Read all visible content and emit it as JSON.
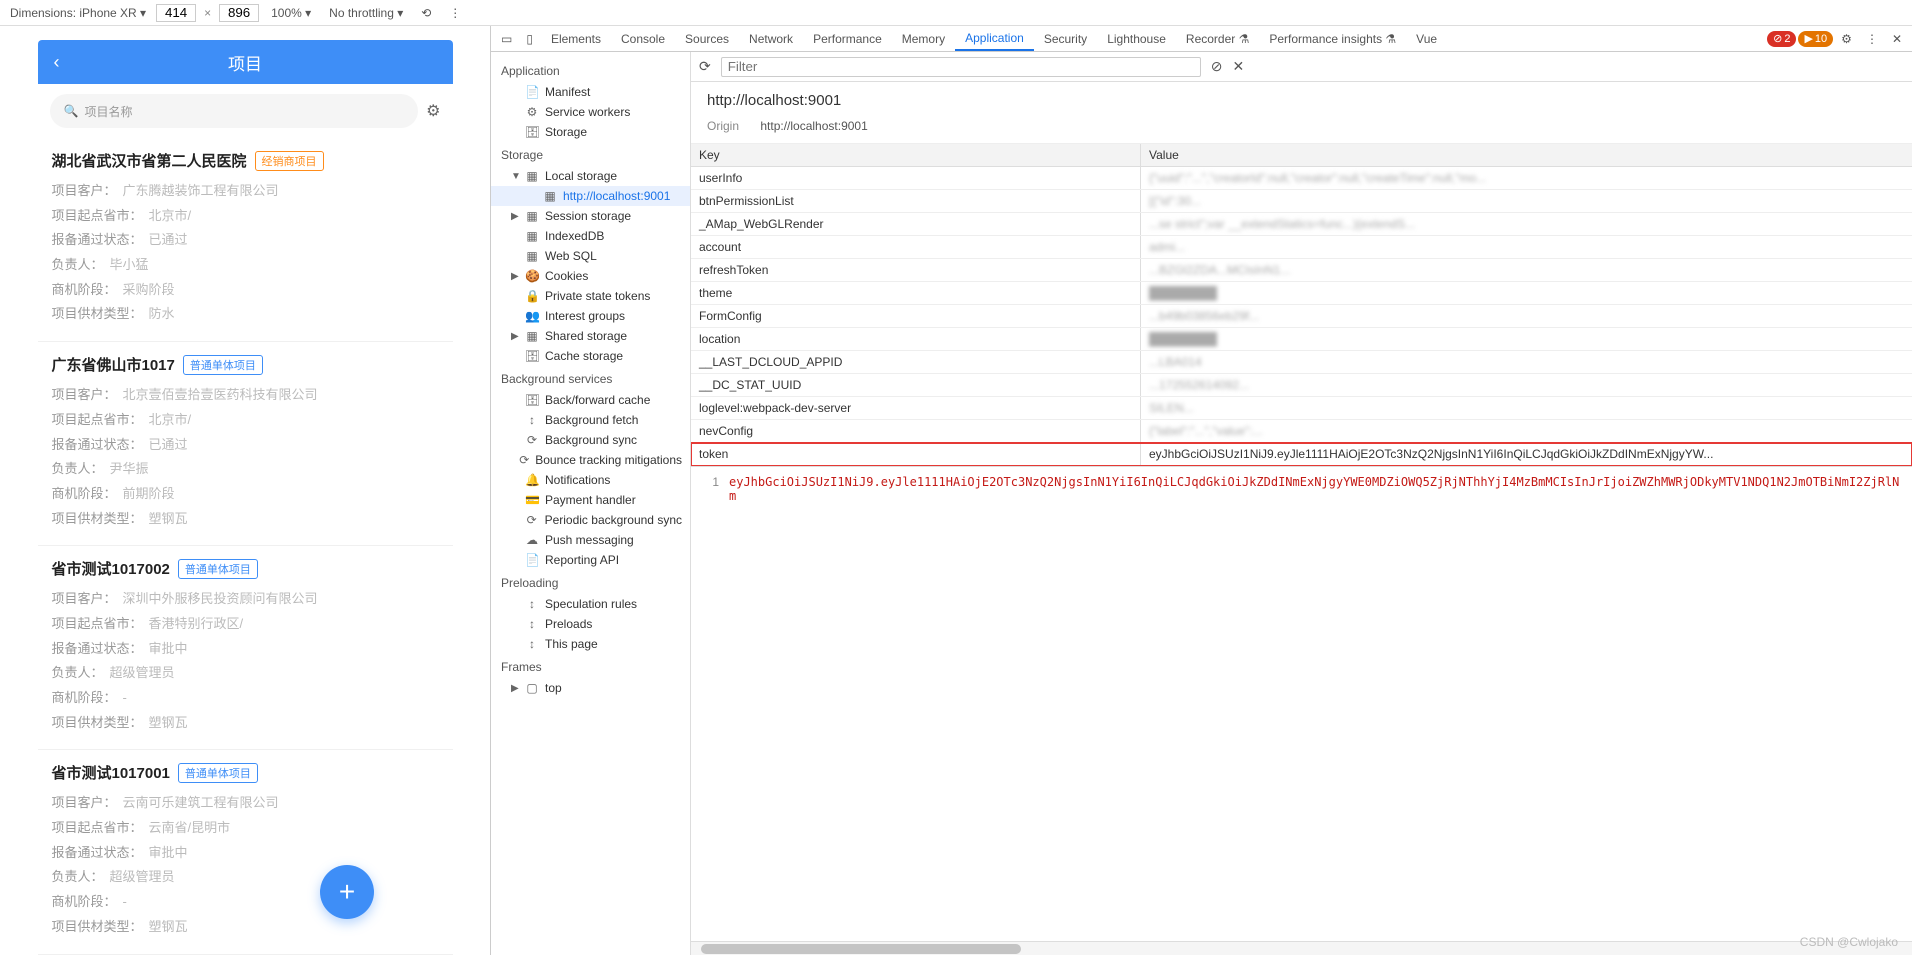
{
  "toolbar": {
    "dimensions_label": "Dimensions: iPhone XR ▾",
    "width": "414",
    "height": "896",
    "zoom": "100% ▾",
    "throttling": "No throttling ▾"
  },
  "phone": {
    "header_title": "项目",
    "search_placeholder": "项目名称",
    "cards": [
      {
        "title": "湖北省武汉市省第二人民医院",
        "badge": "经销商项目",
        "badge_class": "badge-orange",
        "rows": [
          {
            "lbl": "项目客户：",
            "val": "广东腾越装饰工程有限公司"
          },
          {
            "lbl": "项目起点省市：",
            "val": "北京市/"
          },
          {
            "lbl": "报备通过状态：",
            "val": "已通过"
          },
          {
            "lbl": "负责人：",
            "val": "毕小猛"
          },
          {
            "lbl": "商机阶段：",
            "val": "采购阶段"
          },
          {
            "lbl": "项目供材类型：",
            "val": "防水"
          }
        ]
      },
      {
        "title": "广东省佛山市1017",
        "badge": "普通单体项目",
        "badge_class": "badge-blue",
        "rows": [
          {
            "lbl": "项目客户：",
            "val": "北京壹佰壹拾壹医药科技有限公司"
          },
          {
            "lbl": "项目起点省市：",
            "val": "北京市/"
          },
          {
            "lbl": "报备通过状态：",
            "val": "已通过"
          },
          {
            "lbl": "负责人：",
            "val": "尹华振"
          },
          {
            "lbl": "商机阶段：",
            "val": "前期阶段"
          },
          {
            "lbl": "项目供材类型：",
            "val": "塑钢瓦"
          }
        ]
      },
      {
        "title": "省市测试1017002",
        "badge": "普通单体项目",
        "badge_class": "badge-blue",
        "rows": [
          {
            "lbl": "项目客户：",
            "val": "深圳中外服移民投资顾问有限公司"
          },
          {
            "lbl": "项目起点省市：",
            "val": "香港特别行政区/"
          },
          {
            "lbl": "报备通过状态：",
            "val": "审批中"
          },
          {
            "lbl": "负责人：",
            "val": "超级管理员"
          },
          {
            "lbl": "商机阶段：",
            "val": "-"
          },
          {
            "lbl": "项目供材类型：",
            "val": "塑钢瓦"
          }
        ]
      },
      {
        "title": "省市测试1017001",
        "badge": "普通单体项目",
        "badge_class": "badge-blue",
        "rows": [
          {
            "lbl": "项目客户：",
            "val": "云南可乐建筑工程有限公司"
          },
          {
            "lbl": "项目起点省市：",
            "val": "云南省/昆明市"
          },
          {
            "lbl": "报备通过状态：",
            "val": "审批中"
          },
          {
            "lbl": "负责人：",
            "val": "超级管理员"
          },
          {
            "lbl": "商机阶段：",
            "val": "-"
          },
          {
            "lbl": "项目供材类型：",
            "val": "塑钢瓦"
          }
        ]
      }
    ]
  },
  "devtools": {
    "tabs": [
      "Elements",
      "Console",
      "Sources",
      "Network",
      "Performance",
      "Memory",
      "Application",
      "Security",
      "Lighthouse",
      "Recorder ⚗",
      "Performance insights ⚗",
      "Vue"
    ],
    "active_tab": "Application",
    "error_red": "2",
    "error_yellow": "10",
    "sidebar": {
      "groups": [
        {
          "title": "Application",
          "items": [
            {
              "icon": "📄",
              "label": "Manifest"
            },
            {
              "icon": "⚙",
              "label": "Service workers"
            },
            {
              "icon": "🗄",
              "label": "Storage"
            }
          ]
        },
        {
          "title": "Storage",
          "items": [
            {
              "arrow": "▼",
              "icon": "▦",
              "label": "Local storage",
              "children": [
                {
                  "icon": "▦",
                  "label": "http://localhost:9001",
                  "selected": true
                }
              ]
            },
            {
              "arrow": "▶",
              "icon": "▦",
              "label": "Session storage"
            },
            {
              "icon": "▦",
              "label": "IndexedDB"
            },
            {
              "icon": "▦",
              "label": "Web SQL"
            },
            {
              "arrow": "▶",
              "icon": "🍪",
              "label": "Cookies"
            },
            {
              "icon": "🔒",
              "label": "Private state tokens"
            },
            {
              "icon": "👥",
              "label": "Interest groups"
            },
            {
              "arrow": "▶",
              "icon": "▦",
              "label": "Shared storage"
            },
            {
              "icon": "🗄",
              "label": "Cache storage"
            }
          ]
        },
        {
          "title": "Background services",
          "items": [
            {
              "icon": "🗄",
              "label": "Back/forward cache"
            },
            {
              "icon": "↕",
              "label": "Background fetch"
            },
            {
              "icon": "⟳",
              "label": "Background sync"
            },
            {
              "icon": "⟳",
              "label": "Bounce tracking mitigations"
            },
            {
              "icon": "🔔",
              "label": "Notifications"
            },
            {
              "icon": "💳",
              "label": "Payment handler"
            },
            {
              "icon": "⟳",
              "label": "Periodic background sync"
            },
            {
              "icon": "☁",
              "label": "Push messaging"
            },
            {
              "icon": "📄",
              "label": "Reporting API"
            }
          ]
        },
        {
          "title": "Preloading",
          "items": [
            {
              "icon": "↕",
              "label": "Speculation rules"
            },
            {
              "icon": "↕",
              "label": "Preloads"
            },
            {
              "icon": "↕",
              "label": "This page"
            }
          ]
        },
        {
          "title": "Frames",
          "items": [
            {
              "arrow": "▶",
              "icon": "▢",
              "label": "top"
            }
          ]
        }
      ]
    },
    "detail": {
      "filter_placeholder": "Filter",
      "url_display": "http://localhost:9001",
      "origin_label": "Origin",
      "origin_value": "http://localhost:9001",
      "table_headers": {
        "key": "Key",
        "value": "Value"
      },
      "rows": [
        {
          "key": "userInfo",
          "val": "{\"uuid\":\"...\",\"creatorId\":null,\"creator\":null,\"createTime\":null,\"mo..."
        },
        {
          "key": "btnPermissionList",
          "val": "[{\"id\":30..."
        },
        {
          "key": "_AMap_WebGLRender",
          "val": "...se strict\";var __extendStatics=func...){extendS..."
        },
        {
          "key": "account",
          "val": "admi..."
        },
        {
          "key": "refreshToken",
          "val": "...BZGl2ZDA...MCIsInN1..."
        },
        {
          "key": "theme",
          "val": ""
        },
        {
          "key": "FormConfig",
          "val": "...b49b03856eb29f..."
        },
        {
          "key": "location",
          "val": ""
        },
        {
          "key": "__LAST_DCLOUD_APPID",
          "val": "...LBA014"
        },
        {
          "key": "__DC_STAT_UUID",
          "val": "...172552614092..."
        },
        {
          "key": "loglevel:webpack-dev-server",
          "val": "SILEN..."
        },
        {
          "key": "nevConfig",
          "val": "{\"label\":\"...\",\"value\":..."
        },
        {
          "key": "token",
          "val": "eyJhbGciOiJSUzI1NiJ9.eyJle1111HAiOjE2OTc3NzQ2NjgsInN1YiI6InQiLCJqdGkiOiJkZDdINmExNjgyYW...",
          "selected": true
        }
      ],
      "viewer": {
        "line": "1",
        "code": "eyJhbGciOiJSUzI1NiJ9.eyJle1111HAiOjE2OTc3NzQ2NjgsInN1YiI6InQiLCJqdGkiOiJkZDdINmExNjgyYWE0MDZiOWQ5ZjRjNThhYjI4MzBmMCIsInJrIjoiZWZhMWRjODkyMTV1NDQ1N2JmOTBiNmI2ZjRlNm"
      }
    }
  },
  "watermark": "CSDN @Cwlojako"
}
